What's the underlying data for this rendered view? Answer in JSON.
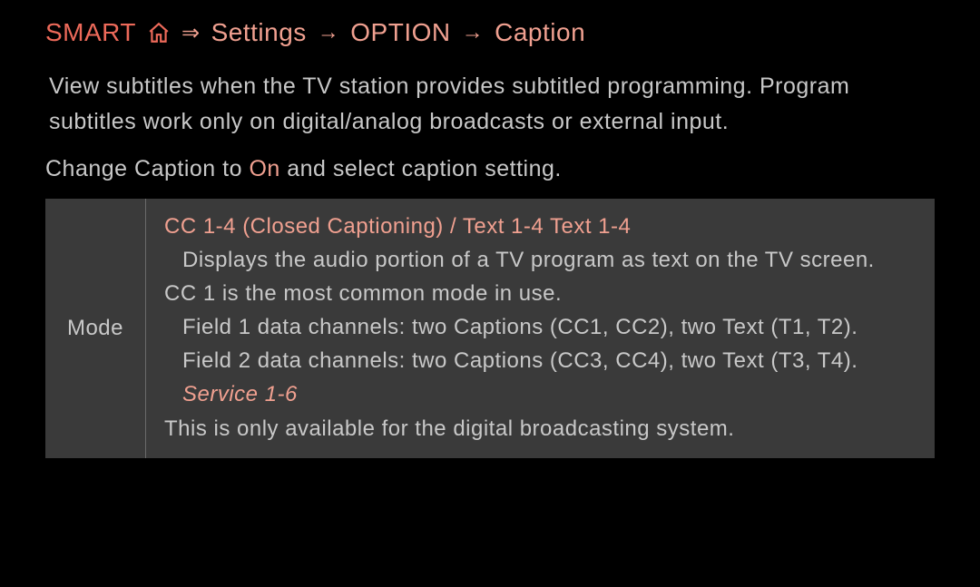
{
  "breadcrumb": {
    "smart": "SMART",
    "settings": "Settings",
    "option": "OPTION",
    "caption": "Caption"
  },
  "intro": "View subtitles when the TV station provides subtitled programming. Program subtitles work only on digital/analog broadcasts or external input.",
  "instruction_prefix": "Change Caption to ",
  "instruction_on": "On",
  "instruction_suffix": " and select caption setting.",
  "table": {
    "label": "Mode",
    "cc_heading": "CC 1-4 (Closed Captioning) / Text 1-4 Text 1-4",
    "cc_line1": "Displays the audio portion of a TV program as text on the TV screen.",
    "cc_line2": "CC 1 is the most common mode in use.",
    "cc_line3": "Field 1 data channels: two Captions (CC1, CC2), two Text (T1, T2).",
    "cc_line4": "Field 2 data channels: two Captions (CC3, CC4), two Text (T3, T4).",
    "service": "Service 1-6",
    "service_note": "This is only available for the digital broadcasting system."
  }
}
